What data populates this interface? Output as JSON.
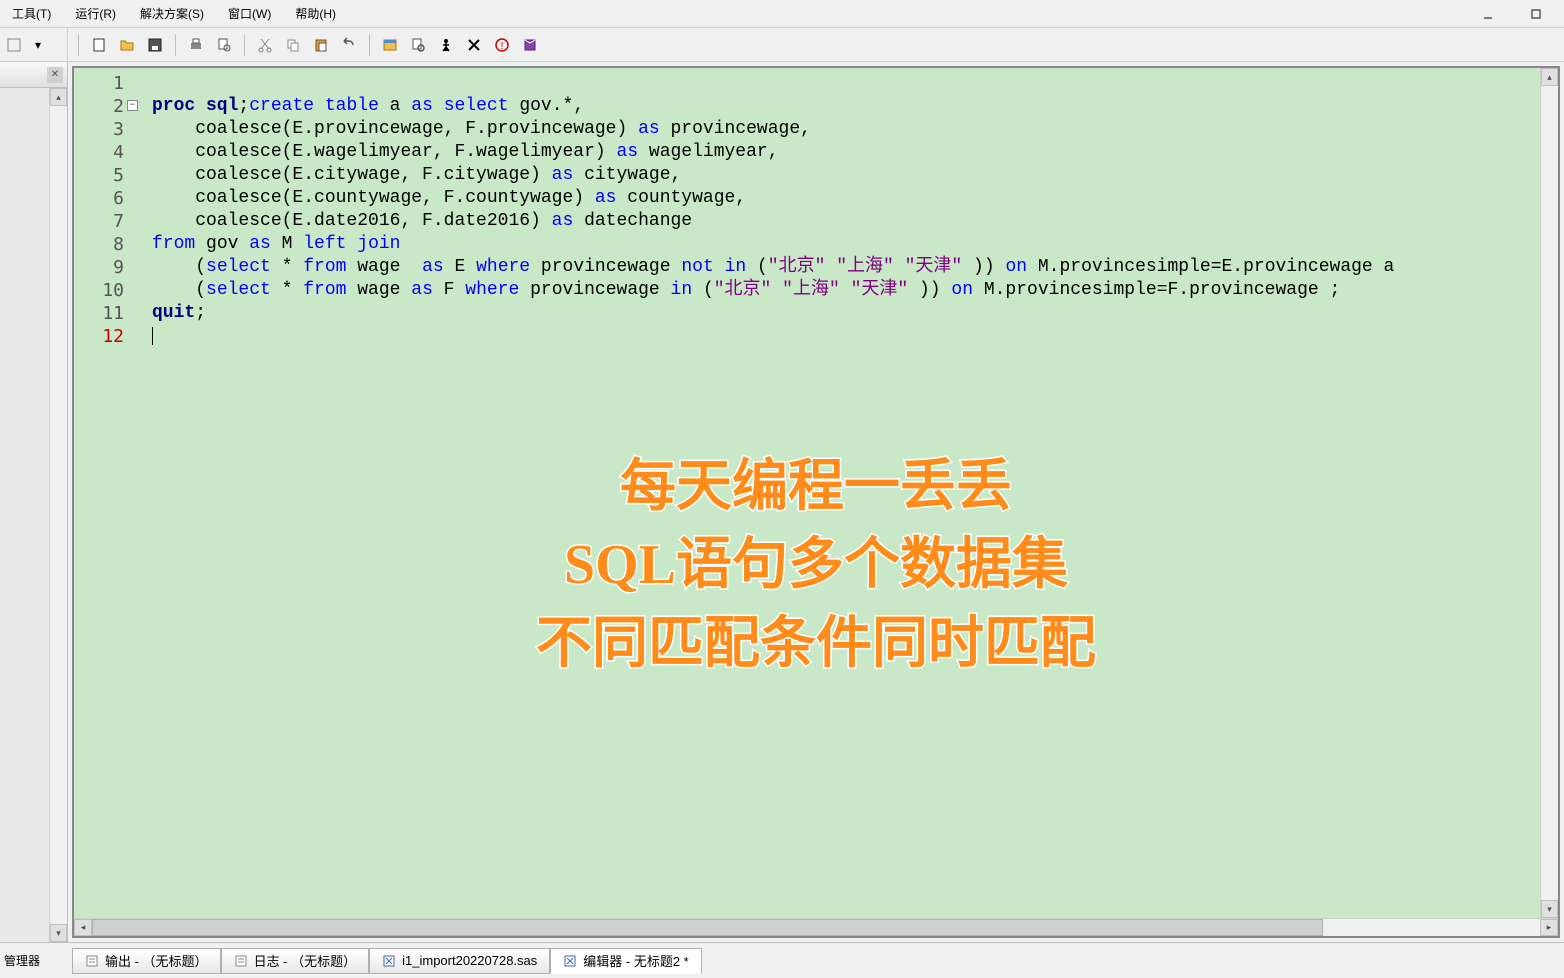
{
  "menu": {
    "tools": "工具(T)",
    "run": "运行(R)",
    "solution": "解决方案(S)",
    "window": "窗口(W)",
    "help": "帮助(H)"
  },
  "code": {
    "lines": [
      {
        "n": "1",
        "html": ""
      },
      {
        "n": "2",
        "fold": true,
        "html": "<span class='kw-navy'>proc sql</span><span class='kw-black'>;</span><span class='kw-blue'>create</span> <span class='kw-blue'>table</span> a <span class='kw-blue'>as</span> <span class='kw-blue'>select</span> <span class='kw-black'>gov.</span><span class='kw-black'>*,</span>"
      },
      {
        "n": "3",
        "html": "    coalesce(E.provincewage, F.provincewage) <span class='kw-blue'>as</span> provincewage,"
      },
      {
        "n": "4",
        "html": "    coalesce(E.wagelimyear, F.wagelimyear) <span class='kw-blue'>as</span> wagelimyear,"
      },
      {
        "n": "5",
        "html": "    coalesce(E.citywage, F.citywage) <span class='kw-blue'>as</span> citywage,"
      },
      {
        "n": "6",
        "html": "    coalesce(E.countywage, F.countywage) <span class='kw-blue'>as</span> countywage,"
      },
      {
        "n": "7",
        "html": "    coalesce(E.date2016, F.date2016) <span class='kw-blue'>as</span> datechange"
      },
      {
        "n": "8",
        "html": "<span class='kw-blue'>from</span> gov <span class='kw-blue'>as</span> M <span class='kw-blue'>left</span> <span class='kw-blue'>join</span>"
      },
      {
        "n": "9",
        "html": "    (<span class='kw-blue'>select</span> * <span class='kw-blue'>from</span> wage  <span class='kw-blue'>as</span> E <span class='kw-blue'>where</span> provincewage <span class='kw-blue'>not</span> <span class='kw-blue'>in</span> (<span class='kw-maroon'>\"北京\"</span> <span class='kw-maroon'>\"上海\"</span> <span class='kw-maroon'>\"天津\"</span> )) <span class='kw-blue'>on</span> M.provincesimple=E.provincewage a"
      },
      {
        "n": "10",
        "html": "    (<span class='kw-blue'>select</span> * <span class='kw-blue'>from</span> wage <span class='kw-blue'>as</span> F <span class='kw-blue'>where</span> provincewage <span class='kw-blue'>in</span> (<span class='kw-maroon'>\"北京\"</span> <span class='kw-maroon'>\"上海\"</span> <span class='kw-maroon'>\"天津\"</span> )) <span class='kw-blue'>on</span> M.provincesimple=F.provincewage ;"
      },
      {
        "n": "11",
        "html": "<span class='kw-navy'>quit</span><span class='kw-black'>;</span>"
      },
      {
        "n": "12",
        "red": true,
        "caret": true,
        "html": ""
      }
    ]
  },
  "overlay": {
    "line1": "每天编程一丢丢",
    "line2": "SQL语句多个数据集",
    "line3": "不同匹配条件同时匹配"
  },
  "tabs": {
    "output": "输出 - （无标题）",
    "log": "日志 - （无标题）",
    "import": "i1_import20220728.sas",
    "editor": "编辑器 - 无标题2 *"
  },
  "sidelabel": "管理器"
}
